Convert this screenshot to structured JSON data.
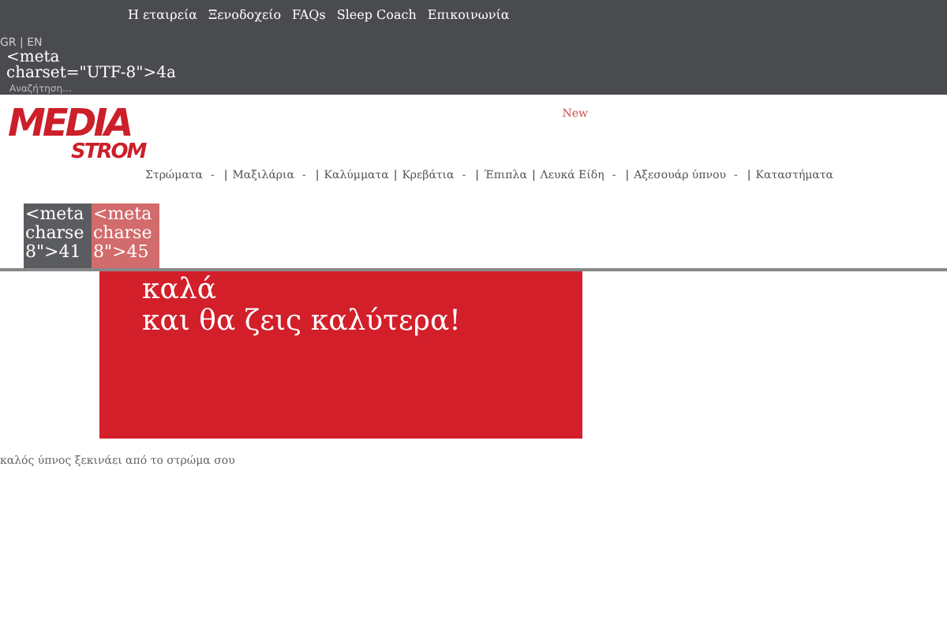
{
  "top_bar": {
    "links": [
      "Η εταιρεία",
      "Ξενοδοχείο",
      "FAQs",
      "Sleep Coach",
      "Επικοινωνία"
    ],
    "language": "GR | EN",
    "meta_text": [
      "<meta",
      "charset=\"UTF-8\">4a"
    ],
    "search": {
      "placeholder": "Αναζήτηση..."
    }
  },
  "header": {
    "logo": {
      "line1": "MEDIA",
      "line2": "STROM"
    },
    "badge": "New",
    "nav": [
      {
        "label": "Στρώματα",
        "dropdown_mark": "-"
      },
      {
        "label": "Μαξιλάρια",
        "dropdown_mark": "-",
        "separator": "|"
      },
      {
        "label": "Καλύμματα",
        "separator": "|"
      },
      {
        "label": "Κρεβάτια",
        "dropdown_mark": "-",
        "separator": "|"
      },
      {
        "label": "Έπιπλα",
        "separator": "|"
      },
      {
        "label": "Λευκά Είδη",
        "dropdown_mark": "-",
        "separator": "|"
      },
      {
        "label": "Αξεσουάρ ύπνου",
        "dropdown_mark": "-",
        "separator": "|"
      },
      {
        "label": "Καταστήματα",
        "separator": "|"
      }
    ],
    "tiles": [
      {
        "lines": [
          "<meta",
          "charse",
          "8\">41"
        ],
        "color": "#5b5c60"
      },
      {
        "lines": [
          "<meta",
          "charse",
          "8\">45"
        ],
        "color": "#d26b6b"
      }
    ]
  },
  "hero": {
    "lines": [
      "καλά",
      "και θα ζεις καλύτερα!"
    ]
  },
  "caption": "καλός ύπνος ξεκινάει από το στρώμα σου"
}
